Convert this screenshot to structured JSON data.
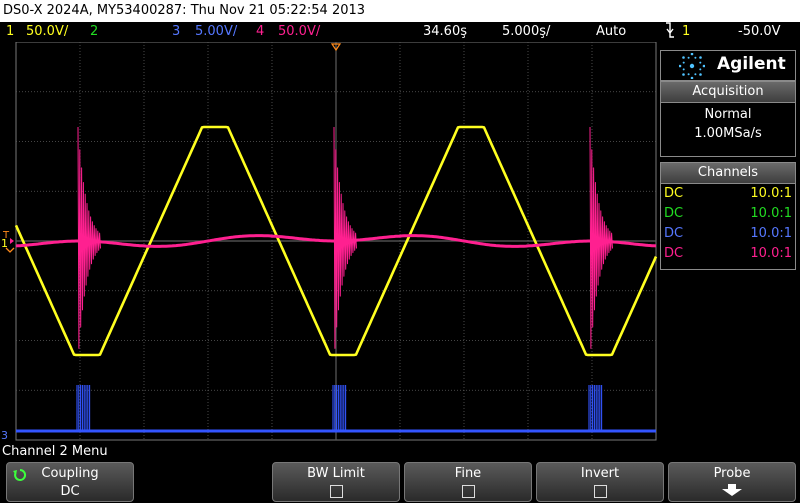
{
  "titlebar": {
    "text": "DS0-X 2024A, MY53400287: Thu Nov 21 05:22:54 2013"
  },
  "status": {
    "ch1_num": "1",
    "ch1_scale": "50.0V/",
    "ch2_num": "2",
    "ch3_num": "3",
    "ch3_scale": "5.00V/",
    "ch4_num": "4",
    "ch4_scale": "50.0V/",
    "time_delay": "34.60ş",
    "time_scale": "5.000ş/",
    "trigger_mode": "Auto",
    "trigger_channel": "1",
    "trigger_level": "-50.0V"
  },
  "markers": {
    "ch1_label": "1",
    "ch3_label": "3",
    "trigger_level_label": "T"
  },
  "colors": {
    "ch1": "#ffff20",
    "ch2": "#22dd22",
    "ch3": "#3355ff",
    "ch4": "#ff2090",
    "trigger": "#ff8a1a",
    "grid": "#5c5c5c"
  },
  "panel": {
    "brand": "Agilent",
    "acquisition_header": "Acquisition",
    "acquisition_mode": "Normal",
    "sample_rate": "1.00MSa/s",
    "channels_header": "Channels",
    "channels": [
      {
        "coupling": "DC",
        "probe": "10.0:1",
        "color": "#ffff20"
      },
      {
        "coupling": "DC",
        "probe": "10.0:1",
        "color": "#22dd22"
      },
      {
        "coupling": "DC",
        "probe": "10.0:1",
        "color": "#3355ff"
      },
      {
        "coupling": "DC",
        "probe": "10.0:1",
        "color": "#ff2090"
      }
    ]
  },
  "menu": {
    "title": "Channel 2 Menu",
    "coupling_label": "Coupling",
    "coupling_value": "DC",
    "bw_limit_label": "BW Limit",
    "fine_label": "Fine",
    "invert_label": "Invert",
    "probe_label": "Probe"
  },
  "icons": {
    "trigger_icon": "falling-edge-trigger-icon",
    "rotate_icon": "knob-rotate-icon",
    "logo": "agilent-spark-logo",
    "arrow": "down-arrow-icon"
  }
}
